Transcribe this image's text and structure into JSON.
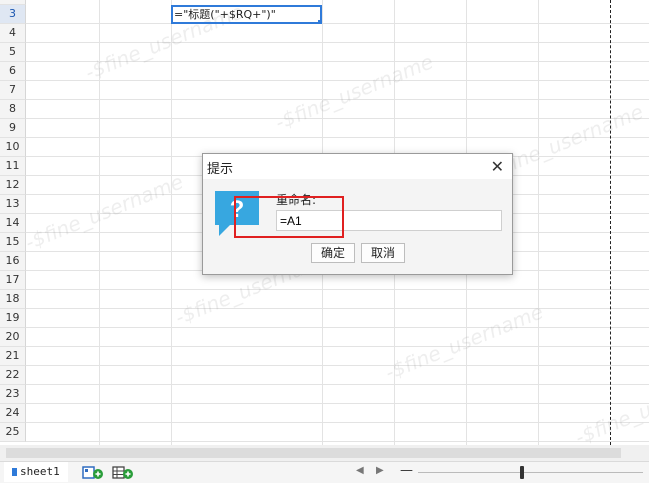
{
  "sheet": {
    "row_numbers": [
      "3",
      "4",
      "5",
      "6",
      "7",
      "8",
      "9",
      "10",
      "11",
      "12",
      "13",
      "14",
      "15",
      "16",
      "17",
      "18",
      "19",
      "20",
      "21",
      "22",
      "23",
      "24",
      "25"
    ],
    "active_cell_formula": "=\"标题(\"+$RQ+\")\"",
    "watermark_text": "-$fine_username",
    "tab_name": "sheet1"
  },
  "dialog": {
    "title": "提示",
    "label": "重命名:",
    "input_value": "=A1",
    "ok_label": "确定",
    "cancel_label": "取消",
    "close_glyph": "✕"
  },
  "statusbar": {
    "prev_glyph": "◀",
    "next_glyph": "▶",
    "zoom_minus": "—"
  },
  "icons": [
    "add-report-icon",
    "add-sheet-icon",
    "question-icon",
    "sheet-flag-icon"
  ],
  "colors": {
    "selection": "#2f7ad9",
    "highlight": "#e02020",
    "question_icon": "#37a7e0"
  }
}
